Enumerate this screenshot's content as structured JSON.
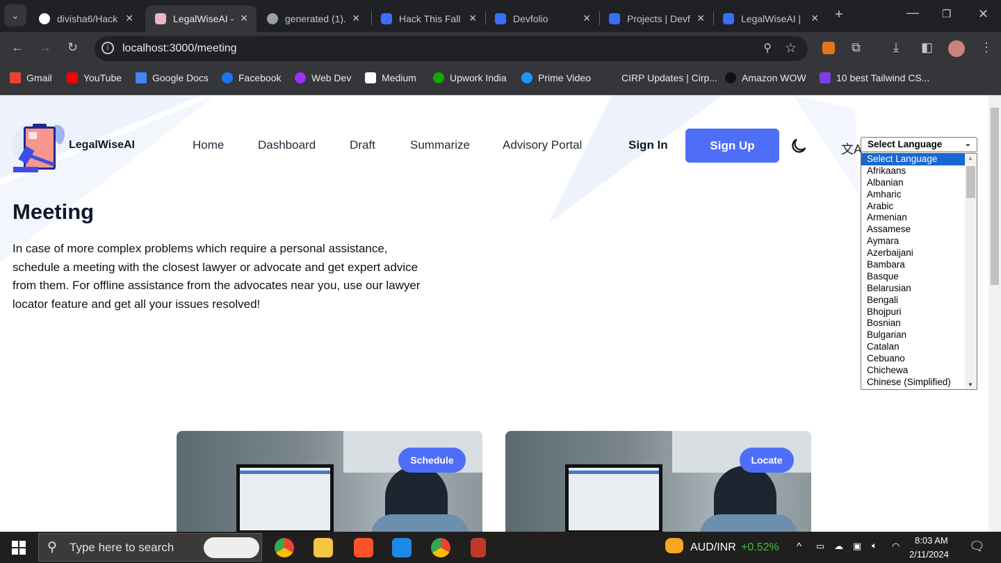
{
  "browser": {
    "tabs": [
      {
        "title": "divisha6/Hack",
        "icon": "github-icon"
      },
      {
        "title": "LegalWiseAI - ",
        "icon": "legalwise-icon",
        "active": true
      },
      {
        "title": "generated (1).",
        "icon": "globe-icon"
      },
      {
        "title": "Hack This Fall",
        "icon": "devfolio-icon"
      },
      {
        "title": "Devfolio",
        "icon": "devfolio-icon"
      },
      {
        "title": "Projects | Devf",
        "icon": "devfolio-icon"
      },
      {
        "title": "LegalWiseAI |",
        "icon": "devfolio-icon"
      }
    ],
    "url": "localhost:3000/meeting",
    "bookmarks": [
      {
        "label": "Gmail",
        "color": "#ea4335"
      },
      {
        "label": "YouTube",
        "color": "#ff0000"
      },
      {
        "label": "Google Docs",
        "color": "#4285f4"
      },
      {
        "label": "Facebook",
        "color": "#1877f2"
      },
      {
        "label": "Web Dev",
        "color": "#9b30ff"
      },
      {
        "label": "Medium",
        "color": "#ffffff"
      },
      {
        "label": "Upwork India",
        "color": "#14a800"
      },
      {
        "label": "Prime Video",
        "color": "#1a98ff"
      },
      {
        "label": "CIRP Updates | Cirp...",
        "color": ""
      },
      {
        "label": "Amazon WOW",
        "color": "#000000"
      },
      {
        "label": "10 best Tailwind CS...",
        "color": "#7b3fe4"
      }
    ]
  },
  "site": {
    "brand": "LegalWiseAI",
    "nav": [
      "Home",
      "Dashboard",
      "Draft",
      "Summarize",
      "Advisory Portal"
    ],
    "sign_in": "Sign In",
    "sign_up": "Sign Up",
    "accent": "#4f6ef7",
    "language_select": {
      "selected": "Select Language",
      "options": [
        "Select Language",
        "Afrikaans",
        "Albanian",
        "Amharic",
        "Arabic",
        "Armenian",
        "Assamese",
        "Aymara",
        "Azerbaijani",
        "Bambara",
        "Basque",
        "Belarusian",
        "Bengali",
        "Bhojpuri",
        "Bosnian",
        "Bulgarian",
        "Catalan",
        "Cebuano",
        "Chichewa",
        "Chinese (Simplified)"
      ]
    },
    "heading": "Meeting",
    "description": "In case of more complex problems which require a personal assistance, schedule a meeting with the closest lawyer or advocate and get expert advice from them. For offline assistance from the advocates near you, use our lawyer locator feature and get all your issues resolved!",
    "cards": [
      {
        "button": "Schedule"
      },
      {
        "button": "Locate"
      }
    ]
  },
  "taskbar": {
    "search_placeholder": "Type here to search",
    "ticker": "AUD/INR",
    "ticker_change": "+0.52%",
    "time": "8:03 AM",
    "date": "2/11/2024"
  }
}
